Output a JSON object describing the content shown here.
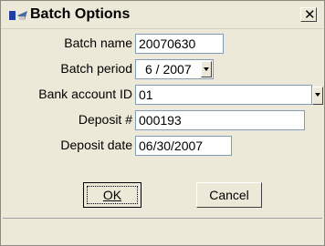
{
  "window": {
    "title": "Batch Options",
    "close_glyph": "✕"
  },
  "form": {
    "batch_name": {
      "label": "Batch name",
      "value": "20070630"
    },
    "batch_period": {
      "label": "Batch period",
      "value": "6 / 2007"
    },
    "bank_account_id": {
      "label": "Bank account ID",
      "value": "01"
    },
    "deposit_number": {
      "label": "Deposit #",
      "value": "000193"
    },
    "deposit_date": {
      "label": "Deposit date",
      "value": "06/30/2007"
    }
  },
  "buttons": {
    "ok": {
      "label": "OK"
    },
    "cancel": {
      "label": "Cancel"
    }
  }
}
